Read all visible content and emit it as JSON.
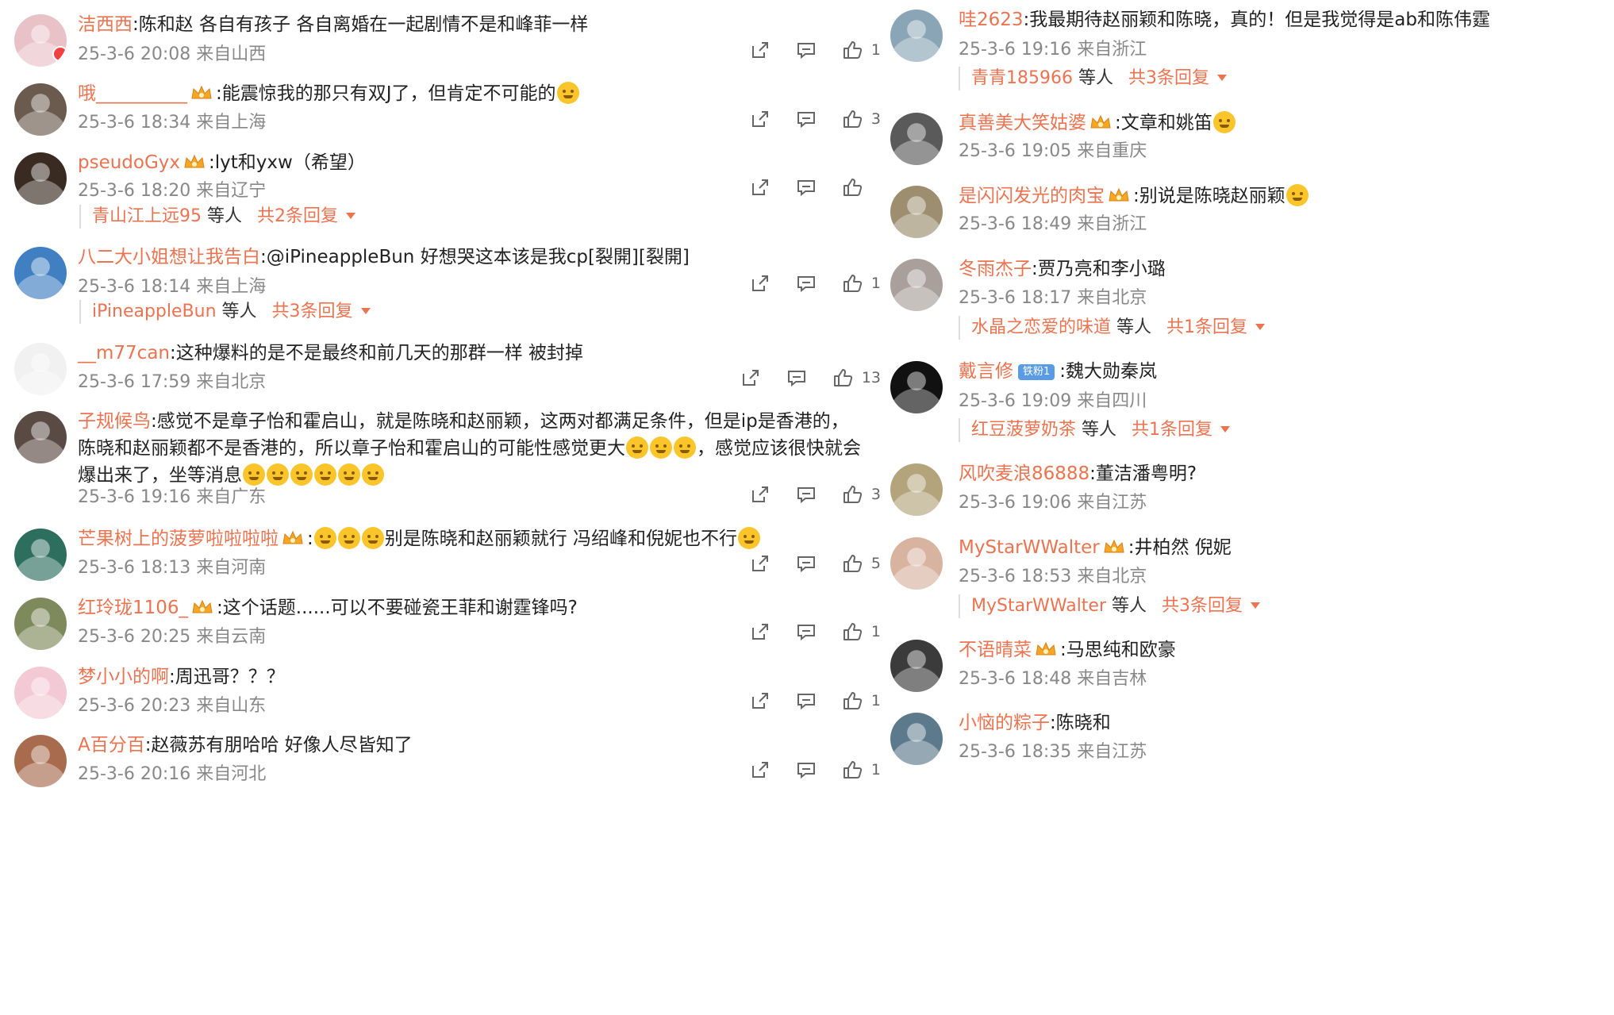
{
  "left": [
    {
      "user": "洁西西",
      "text": ":陈和赵 各自有孩子 各自离婚在一起剧情不是和峰菲一样",
      "time": "25-3-6 20:08",
      "loc": "来自山西",
      "likes": "1"
    },
    {
      "user": "哦__________",
      "text": ":能震惊我的那只有双J了，但肯定不可能的",
      "time": "25-3-6 18:34",
      "loc": "来自上海",
      "likes": "3"
    },
    {
      "user": "pseudoGyx",
      "text": ":lyt和yxw（希望）",
      "time": "25-3-6 18:20",
      "loc": "来自辽宁",
      "likes": "",
      "reply_user": "青山江上远95",
      "reply_mid": " 等人 ",
      "reply_total": "共2条回复"
    },
    {
      "user": "八二大小姐想让我告白",
      "text": ":@iPineappleBun 好想哭这本该是我cp[裂開][裂開]",
      "time": "25-3-6 18:14",
      "loc": "来自上海",
      "likes": "1",
      "reply_user": "iPineappleBun",
      "reply_mid": " 等人 ",
      "reply_total": "共3条回复"
    },
    {
      "user": "__m77can",
      "text": ":这种爆料的是不是最终和前几天的那群一样 被封掉",
      "time": "25-3-6 17:59",
      "loc": "来自北京",
      "likes": "13"
    },
    {
      "user": "子规候鸟",
      "text": ":感觉不是章子怡和霍启山，就是陈晓和赵丽颖，这两对都满足条件，但是ip是香港的，陈晓和赵丽颖都不是香港的，所以章子怡和霍启山的可能性感觉更大",
      "text2": "，感觉应该很快就会爆出来了，坐等消息",
      "time": "25-3-6 19:16",
      "loc": "来自广东",
      "likes": "3"
    },
    {
      "user": "芒果树上的菠萝啦啦啦啦",
      "text": ":",
      "text2": "别是陈晓和赵丽颖就行 冯绍峰和倪妮也不行",
      "time": "25-3-6 18:13",
      "loc": "来自河南",
      "likes": "5"
    },
    {
      "user": "红玲珑1106_",
      "text": ":这个话题......可以不要碰瓷王菲和谢霆锋吗?",
      "time": "25-3-6 20:25",
      "loc": "来自云南",
      "likes": "1"
    },
    {
      "user": "梦小小的啊",
      "text": ":周迅哥？？？",
      "time": "25-3-6 20:23",
      "loc": "来自山东",
      "likes": "1"
    },
    {
      "user": "A百分百",
      "text": ":赵薇苏有朋哈哈 好像人尽皆知了",
      "time": "25-3-6 20:16",
      "loc": "来自河北",
      "likes": "1"
    }
  ],
  "right": [
    {
      "user": "哇2623",
      "text": ":我最期待赵丽颖和陈晓，真的！但是我觉得是ab和陈伟霆",
      "time": "25-3-6 19:16",
      "loc": "来自浙江",
      "reply_user": "青青185966",
      "reply_mid": " 等人 ",
      "reply_total": "共3条回复"
    },
    {
      "user": "真善美大笑姑婆",
      "text": ":文章和姚笛",
      "time": "25-3-6 19:05",
      "loc": "来自重庆"
    },
    {
      "user": "是闪闪发光的肉宝",
      "text": ":别说是陈晓赵丽颖",
      "time": "25-3-6 18:49",
      "loc": "来自浙江"
    },
    {
      "user": "冬雨杰子",
      "text": ":贾乃亮和李小璐",
      "time": "25-3-6 18:17",
      "loc": "来自北京",
      "reply_user": "水晶之恋爱的味道",
      "reply_mid": " 等人 ",
      "reply_total": "共1条回复"
    },
    {
      "user": "戴言修",
      "tag": "铁粉1",
      "text": ":魏大勋秦岚",
      "time": "25-3-6 19:09",
      "loc": "来自四川",
      "reply_user": "红豆菠萝奶茶",
      "reply_mid": " 等人 ",
      "reply_total": "共1条回复"
    },
    {
      "user": "风吹麦浪86888",
      "text": ":董洁潘粤明?",
      "time": "25-3-6 19:06",
      "loc": "来自江苏"
    },
    {
      "user": "MyStarWWalter",
      "text": ":井柏然 倪妮",
      "time": "25-3-6 18:53",
      "loc": "来自北京",
      "reply_user": "MyStarWWalter",
      "reply_mid": " 等人 ",
      "reply_total": "共3条回复"
    },
    {
      "user": "不语晴菜",
      "text": ":马思纯和欧豪",
      "time": "25-3-6 18:48",
      "loc": "来自吉林"
    },
    {
      "user": "小恼的粽子",
      "text": ":陈晓和",
      "time": "25-3-6 18:35",
      "loc": "来自江苏"
    }
  ]
}
